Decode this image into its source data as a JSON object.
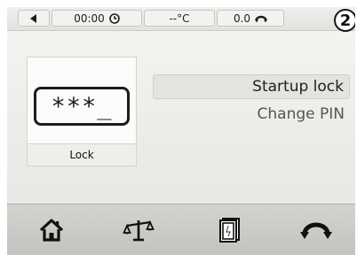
{
  "statusbar": {
    "back_icon": "back-triangle-icon",
    "time": "00:00",
    "time_icon": "clock-icon",
    "temperature": "--°C",
    "speed": "0.0",
    "speed_icon": "rotation-icon"
  },
  "badge": "2",
  "lock_tile": {
    "display_text": "***_",
    "label": "Lock"
  },
  "menu": {
    "items": [
      {
        "label": "Startup lock",
        "selected": true
      },
      {
        "label": "Change PIN",
        "selected": false
      }
    ]
  },
  "navbar": {
    "items": [
      {
        "icon": "home-icon"
      },
      {
        "icon": "balance-icon"
      },
      {
        "icon": "book-icon"
      },
      {
        "icon": "rotation-icon"
      }
    ]
  },
  "colors": {
    "background": "#ecebe7",
    "navbar": "#c8c7c3",
    "selected": "#e4e3df",
    "text": "#202020"
  }
}
